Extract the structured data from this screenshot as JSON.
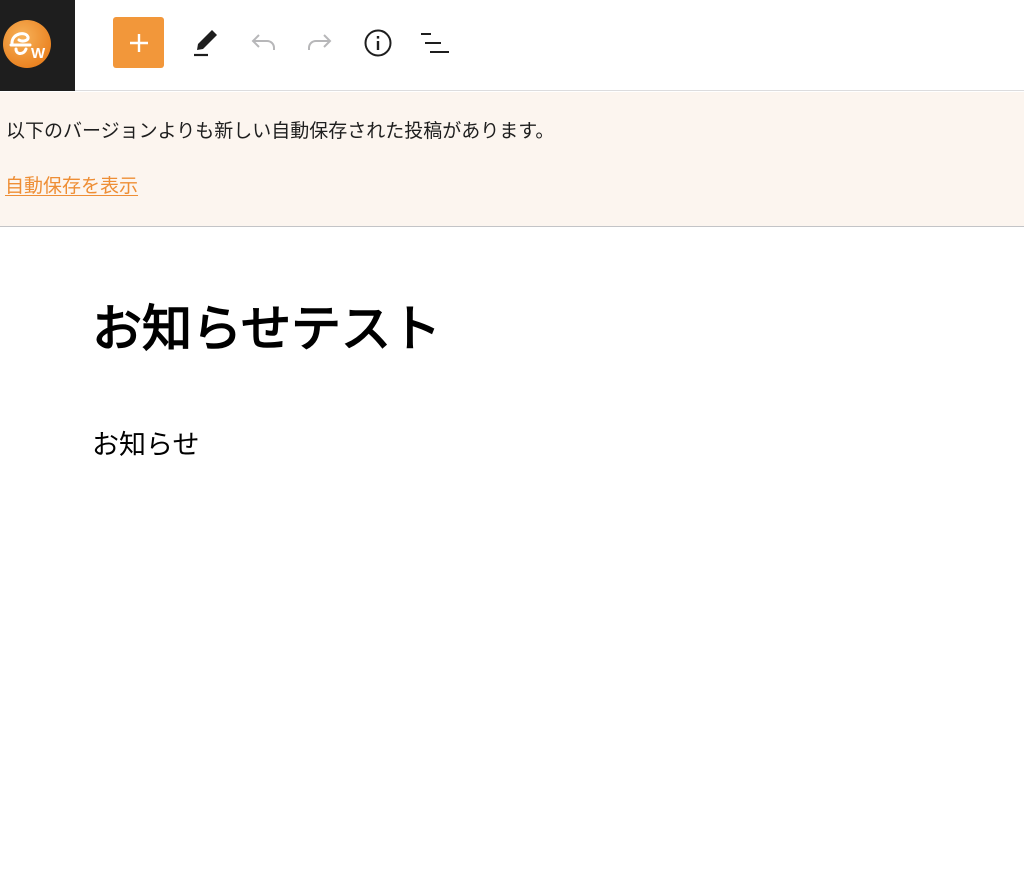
{
  "toolbar": {
    "logo": {
      "icon": "site-logo-icon",
      "letter": "W"
    },
    "add_block": {
      "icon": "plus-icon",
      "color": "#f2973a"
    },
    "tools": {
      "icon": "pencil-icon"
    },
    "undo": {
      "icon": "undo-icon"
    },
    "redo": {
      "icon": "redo-icon"
    },
    "details": {
      "icon": "info-icon"
    },
    "outline": {
      "icon": "list-view-icon"
    }
  },
  "notice": {
    "message": "以下のバージョンよりも新しい自動保存された投稿があります。",
    "link_label": "自動保存を表示",
    "link_color": "#ee8e35",
    "background": "#fcf5ef"
  },
  "editor": {
    "title": "お知らせテスト",
    "paragraph": "お知らせ"
  }
}
